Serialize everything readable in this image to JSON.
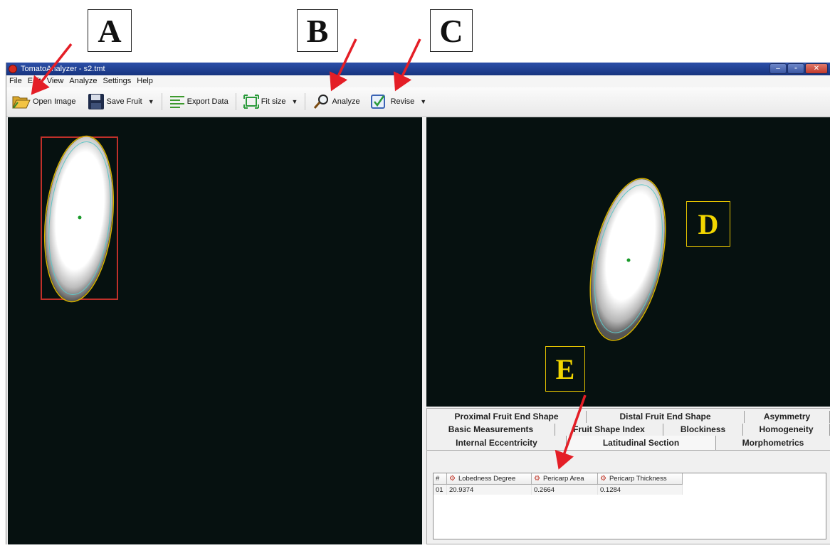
{
  "window": {
    "title": "TomatoAnalyzer - s2.tmt"
  },
  "menu": {
    "items": [
      "File",
      "Edit",
      "View",
      "Analyze",
      "Settings",
      "Help"
    ]
  },
  "toolbar": {
    "open_image": "Open Image",
    "save_fruit": "Save Fruit",
    "export_data": "Export Data",
    "fit_size": "Fit size",
    "analyze": "Analyze",
    "revise": "Revise"
  },
  "callouts": {
    "a": "A",
    "b": "B",
    "c": "C",
    "d": "D",
    "e": "E"
  },
  "tabs": {
    "row1": [
      "Proximal Fruit End Shape",
      "Distal Fruit End Shape",
      "Asymmetry"
    ],
    "row2": [
      "Basic Measurements",
      "Fruit Shape Index",
      "Blockiness",
      "Homogeneity"
    ],
    "row3": [
      "Internal Eccentricity",
      "Latitudinal Section",
      "Morphometrics"
    ]
  },
  "results": {
    "columns": [
      "#",
      "Lobedness Degree",
      "Pericarp Area",
      "Pericarp Thickness"
    ],
    "rows": [
      [
        "01",
        "20.9374",
        "0.2664",
        "0.1284"
      ]
    ]
  },
  "colors": {
    "accent_arrow": "#e41e26",
    "callout_yellow": "#f2d600",
    "outline_yellow": "#d6b200",
    "outline_cyan": "#5fc7c7",
    "bbox_red": "#c0302a",
    "canvas_bg": "#061110"
  }
}
